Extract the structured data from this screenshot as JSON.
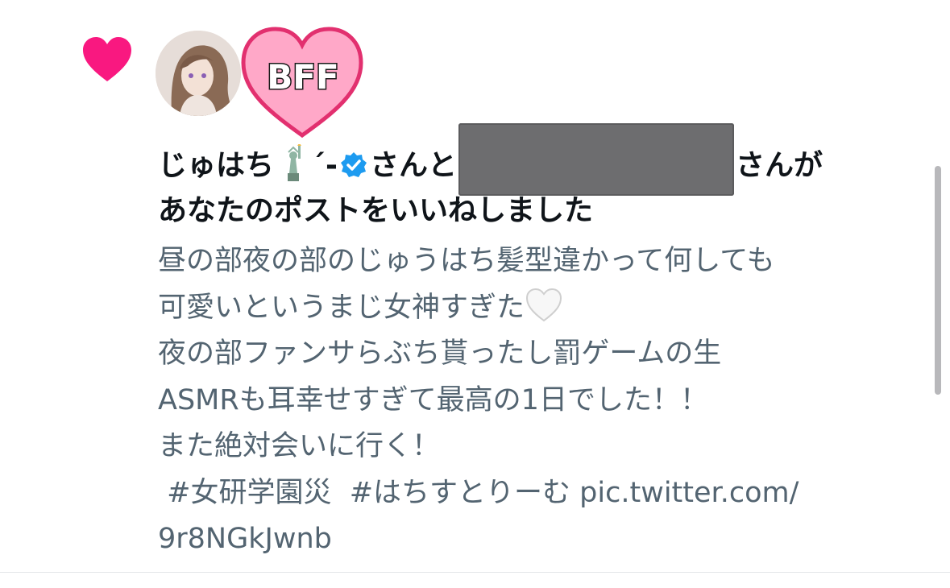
{
  "notification": {
    "icon": "heart-icon",
    "accent_color": "#f91880",
    "badge_text": "BFF",
    "headline": {
      "user1_name": "じゅはち",
      "user1_suffix": "´-",
      "user1_verified": true,
      "connector": "さんと",
      "connector_end": "さんが",
      "action": "あなたのポストをいいねしました"
    },
    "post_lines": [
      "昼の部夜の部のじゅうはち髪型違かって何しても",
      "可愛いというまじ女神すぎた",
      "夜の部ファンサらぶち貰ったし罰ゲームの生",
      "ASMRも耳幸せすぎて最高の1日でした！！",
      "また絶対会いに行く！",
      " #女研学園災  #はちすとりーむ pic.twitter.com/",
      "9r8NGkJwnb"
    ]
  },
  "colors": {
    "text_primary": "#0f1419",
    "text_secondary": "#536471",
    "verified": "#1d9bf0"
  }
}
